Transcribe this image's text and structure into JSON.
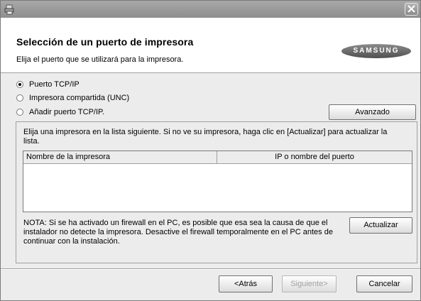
{
  "window": {
    "title": ""
  },
  "header": {
    "title": "Selección de un puerto de impresora",
    "subtitle": "Elija el puerto que se utilizará para la impresora.",
    "logo_text": "SAMSUNG"
  },
  "options": [
    {
      "label": "Puerto TCP/IP",
      "selected": true
    },
    {
      "label": "Impresora compartida (UNC)",
      "selected": false
    },
    {
      "label": "Añadir puerto TCP/IP.",
      "selected": false
    }
  ],
  "advanced_button": "Avanzado",
  "instructions": "Elija una impresora en la lista siguiente. Si no ve su impresora, haga clic en [Actualizar] para actualizar la lista.",
  "table": {
    "columns": [
      "Nombre de la impresora",
      "IP o nombre del puerto"
    ],
    "rows": []
  },
  "note": "NOTA: Si se ha activado un firewall en el PC, es posible que esa sea la causa de que el instalador no detecte la impresora. Desactive el firewall temporalmente en el PC antes de continuar con la instalación.",
  "refresh_button": "Actualizar",
  "footer": {
    "back": "<Atrás",
    "next": "Siguiente>",
    "cancel": "Cancelar"
  }
}
